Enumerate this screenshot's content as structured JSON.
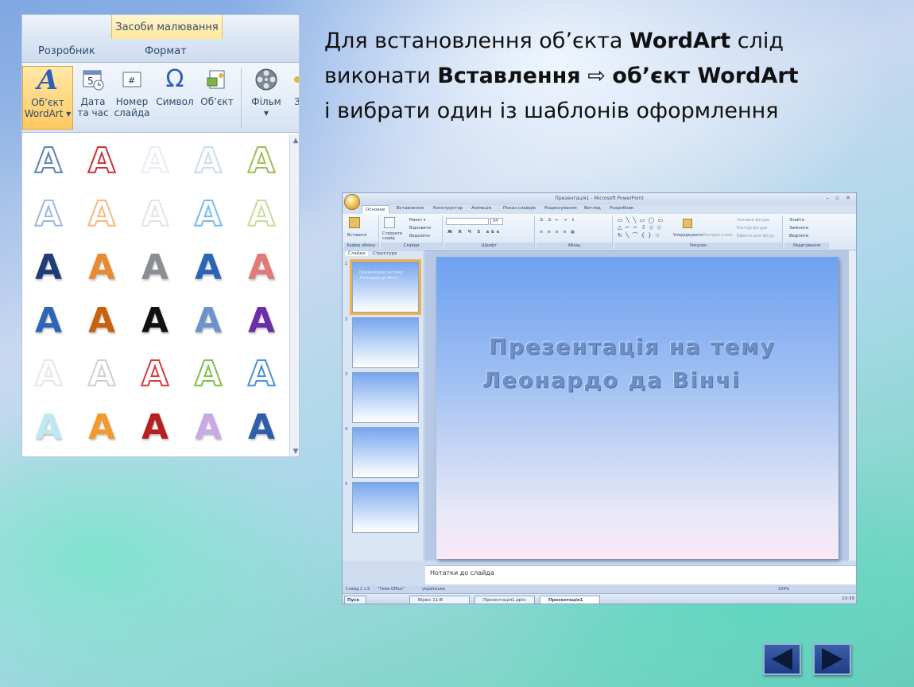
{
  "ribbon": {
    "contextual_tab": "Засоби малювання",
    "tabs": [
      "Розробник",
      "Формат"
    ],
    "tools": [
      {
        "line1": "Об’єкт",
        "line2": "WordArt ▾"
      },
      {
        "line1": "Дата",
        "line2": "та час"
      },
      {
        "line1": "Номер",
        "line2": "слайда"
      },
      {
        "line1": "Символ",
        "line2": ""
      },
      {
        "line1": "Об’єкт",
        "line2": ""
      },
      {
        "line1": "Фільм",
        "line2": "▾"
      },
      {
        "line1": "З",
        "line2": ""
      }
    ],
    "gallery_glyph": "A",
    "gallery_colors": [
      [
        "#5b82b8",
        "#c8343a",
        "#e8ecf2",
        "#c9dbee",
        "#9bbf55"
      ],
      [
        "#9fb6e6",
        "#f6b97a",
        "#e2e4e8",
        "#79b9ee",
        "#c6dd9c"
      ],
      [
        "#1f3e78",
        "#e88a2e",
        "#8a8e94",
        "#2c64b8",
        "#e07a78"
      ],
      [
        "#2e66b8",
        "#c8620e",
        "#111111",
        "#6d94c8",
        "#6a2fa6"
      ],
      [
        "#e6e6e6",
        "#cfcfcf",
        "#d83a3a",
        "#7ec04a",
        "#4a90d8"
      ],
      [
        "#bfe8f5",
        "#f39a2e",
        "#b81e1e",
        "#c9a8e6",
        "#2f5fa8"
      ]
    ]
  },
  "instruction": {
    "line1_pre": "Для встановлення об’єкта ",
    "line1_bold": "WordArt",
    "line1_post": " слід",
    "line2_pre": "виконати ",
    "line2_bold1": "Вставлення",
    "arrow": " ⇨ ",
    "line2_bold2": "об’єкт WordArt",
    "line3": "і вибрати один із шаблонів оформлення"
  },
  "ppt": {
    "window_title": "Презентація1 - Microsoft PowerPoint",
    "tabs": [
      "Основне",
      "Вставлення",
      "Конструктор",
      "Анімація",
      "Показ слайдів",
      "Рецензування",
      "Вигляд",
      "Розробник"
    ],
    "groups": {
      "clipboard": "Буфер обміну",
      "slides": "Слайди",
      "font": "Шрифт",
      "paragraph": "Абзац",
      "drawing": "Рисунок",
      "editing": "Редагування"
    },
    "buttons": {
      "paste": "Вставити",
      "new_slide": "Створити слайд",
      "layout": "Макет ▾",
      "reset": "Відновити",
      "delete": "Видалити",
      "arrange": "Упорядкувати",
      "quick_styles": "Експрес-стилі",
      "fill": "Заливка фігури",
      "outline": "Контур фігури",
      "effects": "Ефекти для фігур",
      "find": "Знайти",
      "replace": "Замінити",
      "select": "Виділити",
      "font_size": "54"
    },
    "left_tabs": [
      "Слайди",
      "Структура"
    ],
    "thumbs": [
      {
        "num": "1",
        "text": "Презентація на тему Леонардо да Вінчі"
      },
      {
        "num": "2",
        "text": ""
      },
      {
        "num": "3",
        "text": ""
      },
      {
        "num": "4",
        "text": ""
      },
      {
        "num": "5",
        "text": ""
      }
    ],
    "slide_title_line1": "Презентація на тему",
    "slide_title_line2": "Леонардо да Вінчі",
    "notes_placeholder": "Нотатки до слайда",
    "status": {
      "slide": "Слайд 1 з 5",
      "theme": "\"Тема Office\"",
      "lang": "українська",
      "zoom": "104%"
    },
    "taskbar": {
      "start": "Пуск",
      "items": [
        "Вірюс 11-В",
        "Презентація1.pptx",
        "Презентація1"
      ],
      "clock": "10:39"
    }
  },
  "nav": {
    "prev": "◀",
    "next": "▶"
  }
}
